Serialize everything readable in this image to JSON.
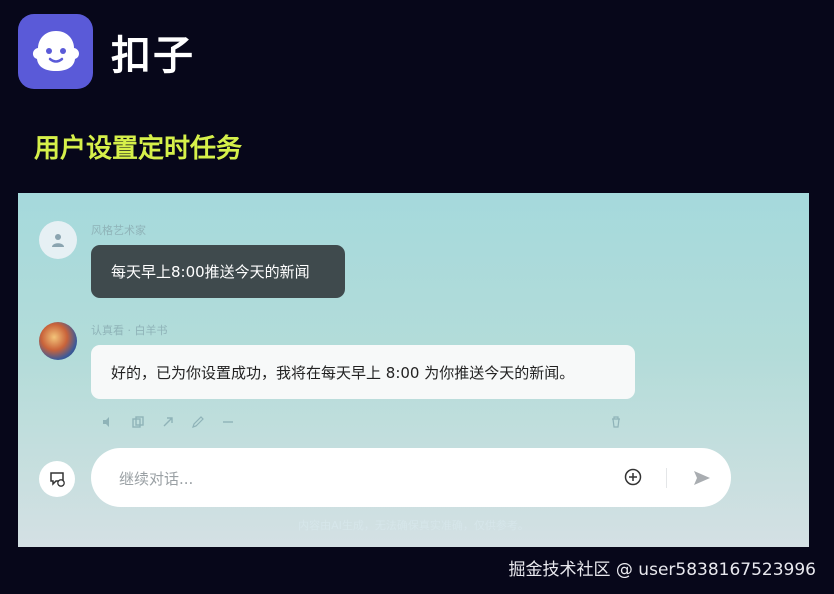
{
  "brand": {
    "name": "扣子",
    "logo_icon": "ghost-icon",
    "logo_color": "#5a5ad8"
  },
  "heading": {
    "text": "用户设置定时任务",
    "color": "#d6f04a"
  },
  "chat": {
    "user_message": {
      "sender": "风格艺术家",
      "text": "每天早上8:00推送今天的新闻"
    },
    "bot_message": {
      "sender": "认真看 · 白羊书",
      "text": "好的，已为你设置成功，我将在每天早上 8:00 为你推送今天的新闻。"
    },
    "action_icons": [
      "speaker-icon",
      "copy-icon",
      "share-icon",
      "edit-icon",
      "more-icon",
      "delete-icon"
    ],
    "input": {
      "placeholder": "继续对话..."
    },
    "disclaimer": "内容由AI生成，无法确保真实准确，仅供参考。"
  },
  "watermark": "掘金技术社区 @ user5838167523996"
}
